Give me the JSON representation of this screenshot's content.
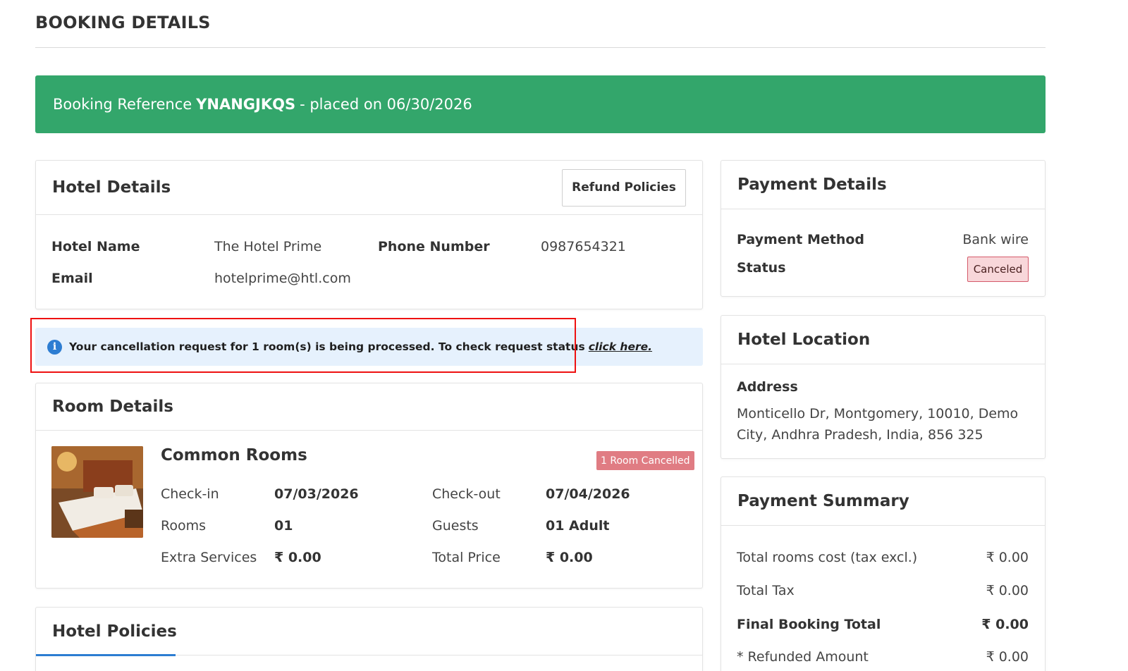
{
  "page_title": "BOOKING DETAILS",
  "banner": {
    "prefix": "Booking Reference",
    "reference": "YNANGJKQS",
    "suffix": "- placed on 06/30/2026",
    "color": "#33a66b"
  },
  "hotel_details": {
    "title": "Hotel Details",
    "refund_button": "Refund Policies",
    "hotel_name_label": "Hotel Name",
    "hotel_name": "The Hotel Prime",
    "phone_label": "Phone Number",
    "phone": "0987654321",
    "email_label": "Email",
    "email": "hotelprime@htl.com"
  },
  "alert": {
    "icon": "info-icon",
    "message": "Your cancellation request for 1 room(s) is being processed. To check request status",
    "link": "click here."
  },
  "room_details": {
    "title": "Room Details",
    "room_name": "Common Rooms",
    "badge": "1 Room Cancelled",
    "checkin_label": "Check-in",
    "checkin": "07/03/2026",
    "checkout_label": "Check-out",
    "checkout": "07/04/2026",
    "rooms_label": "Rooms",
    "rooms": "01",
    "guests_label": "Guests",
    "guests": "01 Adult",
    "extra_label": "Extra Services",
    "extra": "₹ 0.00",
    "total_label": "Total Price",
    "total": "₹ 0.00"
  },
  "hotel_policies": {
    "title": "Hotel Policies"
  },
  "payment_details": {
    "title": "Payment Details",
    "method_label": "Payment Method",
    "method": "Bank wire",
    "status_label": "Status",
    "status": "Canceled"
  },
  "hotel_location": {
    "title": "Hotel Location",
    "address_label": "Address",
    "address": "Monticello Dr, Montgomery, 10010, Demo City, Andhra Pradesh, India, 856 325"
  },
  "payment_summary": {
    "title": "Payment Summary",
    "rows": [
      {
        "label": "Total rooms cost (tax excl.)",
        "value": "₹ 0.00"
      },
      {
        "label": "Total Tax",
        "value": "₹ 0.00"
      },
      {
        "label": "Final Booking Total",
        "value": "₹ 0.00"
      },
      {
        "label": "* Refunded Amount",
        "value": "₹ 0.00"
      }
    ]
  }
}
